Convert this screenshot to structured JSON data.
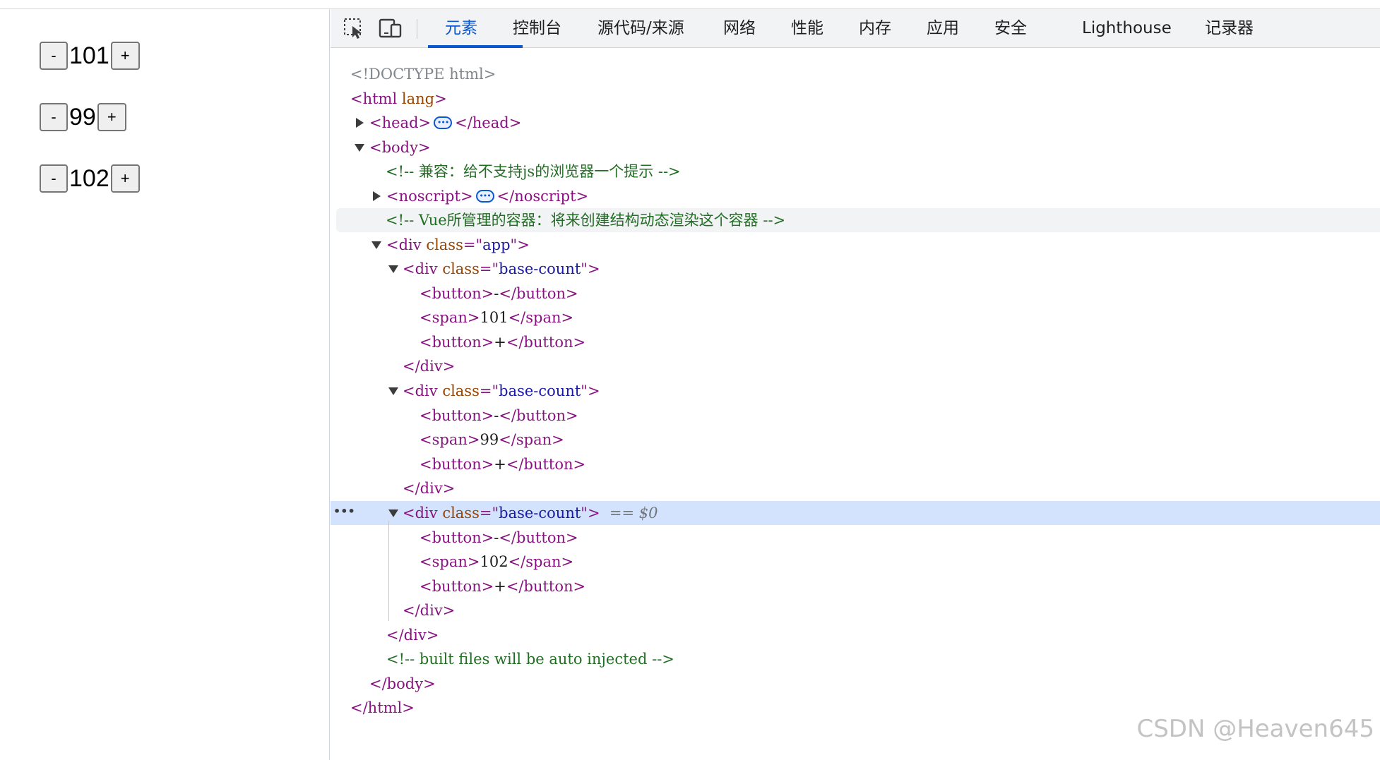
{
  "page": {
    "counters": [
      {
        "minus": "-",
        "value": "101",
        "plus": "+"
      },
      {
        "minus": "-",
        "value": "99",
        "plus": "+"
      },
      {
        "minus": "-",
        "value": "102",
        "plus": "+"
      }
    ]
  },
  "devtools": {
    "toolbar": {
      "inspect_icon": "inspect-element-icon",
      "device_icon": "device-toolbar-icon",
      "tabs": [
        "元素",
        "控制台",
        "源代码/来源",
        "网络",
        "性能",
        "内存",
        "应用",
        "安全",
        "Lighthouse",
        "记录器"
      ],
      "active_tab": "元素"
    },
    "tree": {
      "doctype": "<!DOCTYPE html>",
      "html_open_tag": "<html",
      "html_attr": "lang",
      "gt": ">",
      "head_open": "<head>",
      "head_close": "</head>",
      "body_open": "<body>",
      "comment_compat": "<!-- 兼容：给不支持js的浏览器一个提示 -->",
      "noscript_open": "<noscript>",
      "noscript_close": "</noscript>",
      "comment_vue": "<!-- Vue所管理的容器：将来创建结构动态渲染这个容器 -->",
      "div_open": "<div",
      "class_attr": "class",
      "eq": "=\"",
      "quote_gt": "\">",
      "app_class": "app",
      "base_count_class": "base-count",
      "button_open": "<button>",
      "button_close": "</button>",
      "span_open": "<span>",
      "span_close": "</span>",
      "minus_text": "-",
      "plus_text": "+",
      "values": [
        "101",
        "99",
        "102"
      ],
      "div_close": "</div>",
      "selected_marker": "== $0",
      "comment_built": "<!-- built files will be auto injected -->",
      "body_close": "</body>",
      "html_close": "</html>",
      "more_actions": "•••"
    }
  },
  "watermark": "CSDN @Heaven645"
}
